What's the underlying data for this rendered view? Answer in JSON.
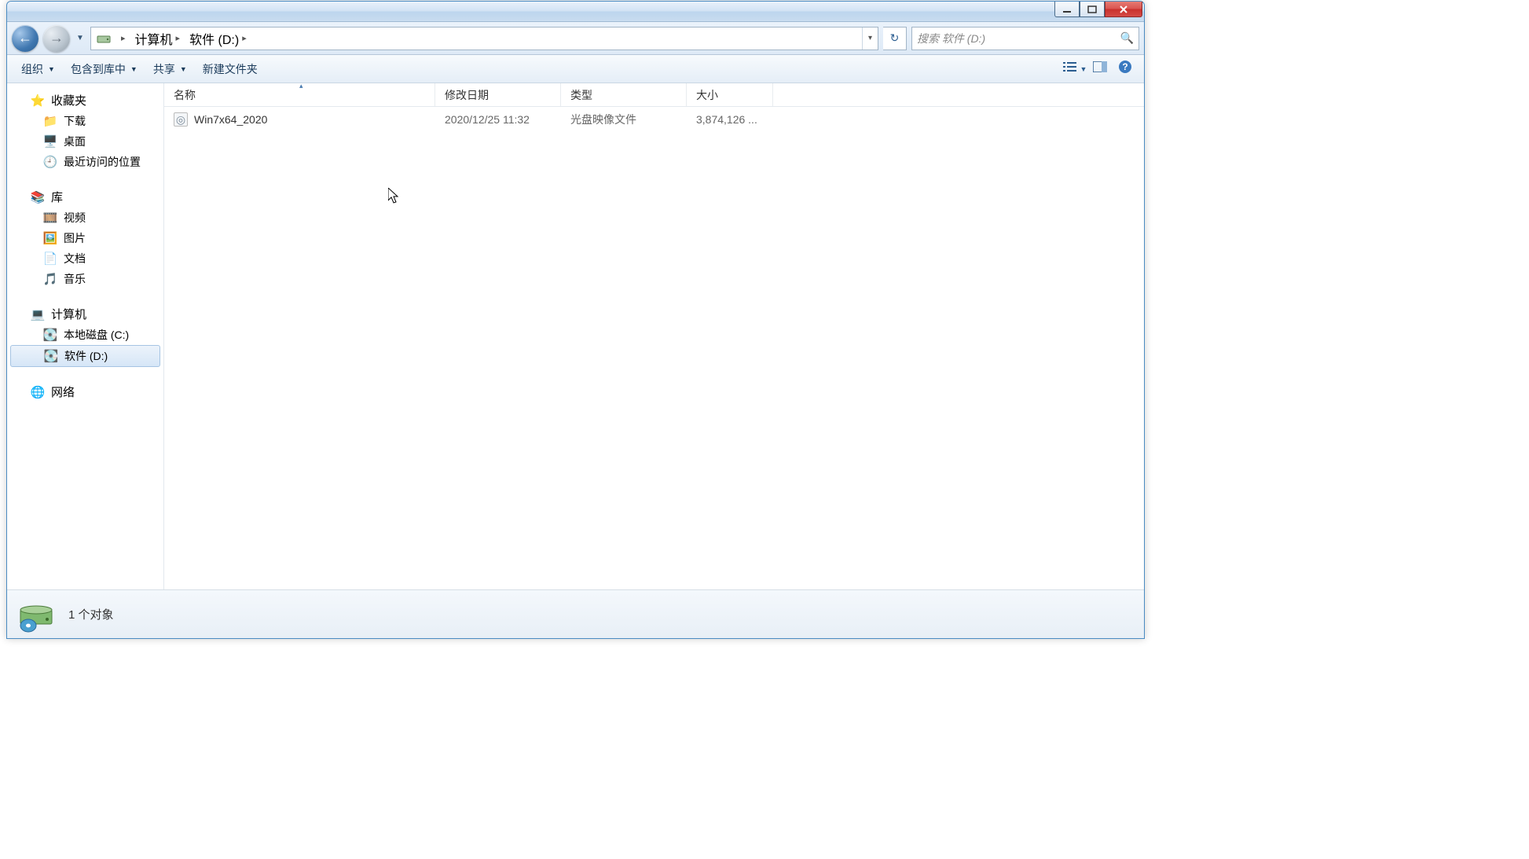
{
  "breadcrumb": {
    "root_sep": "▸",
    "segments": [
      "计算机",
      "软件 (D:)"
    ]
  },
  "search": {
    "placeholder": "搜索 软件 (D:)"
  },
  "toolbar": {
    "organize": "组织",
    "include": "包含到库中",
    "share": "共享",
    "new_folder": "新建文件夹"
  },
  "sidebar": {
    "favorites": {
      "label": "收藏夹",
      "items": [
        "下载",
        "桌面",
        "最近访问的位置"
      ]
    },
    "libraries": {
      "label": "库",
      "items": [
        "视频",
        "图片",
        "文档",
        "音乐"
      ]
    },
    "computer": {
      "label": "计算机",
      "items": [
        "本地磁盘 (C:)",
        "软件 (D:)"
      ],
      "selected_index": 1
    },
    "network": {
      "label": "网络"
    }
  },
  "columns": {
    "name": "名称",
    "date": "修改日期",
    "type": "类型",
    "size": "大小"
  },
  "files": [
    {
      "name": "Win7x64_2020",
      "date": "2020/12/25 11:32",
      "type": "光盘映像文件",
      "size": "3,874,126 ..."
    }
  ],
  "statusbar": {
    "text": "1 个对象"
  },
  "colors": {
    "accent": "#2b5d90"
  }
}
